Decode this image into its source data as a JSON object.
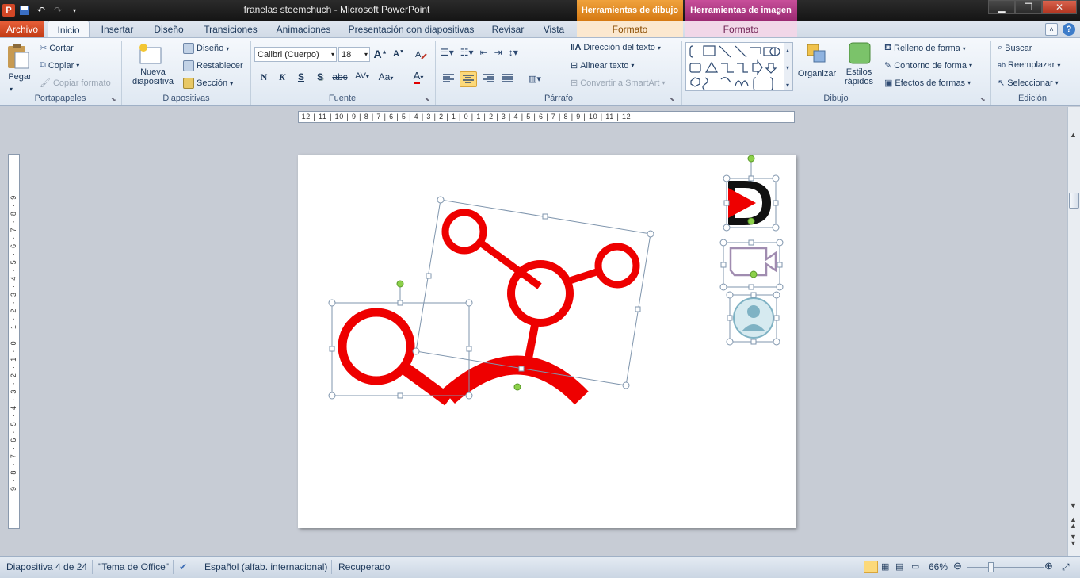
{
  "title_bar": {
    "document_title": "franelas steemchuch  -  Microsoft PowerPoint",
    "context_tabs": [
      "Herramientas de dibujo",
      "Herramientas de imagen"
    ],
    "app_icon": "P"
  },
  "tabs": {
    "file": "Archivo",
    "items": [
      "Inicio",
      "Insertar",
      "Diseño",
      "Transiciones",
      "Animaciones",
      "Presentación con diapositivas",
      "Revisar",
      "Vista"
    ],
    "context_sub": [
      "Formato",
      "Formato"
    ]
  },
  "ribbon": {
    "clipboard": {
      "paste": "Pegar",
      "cut": "Cortar",
      "copy": "Copiar",
      "format_painter": "Copiar formato",
      "label": "Portapapeles"
    },
    "slides": {
      "new_slide_1": "Nueva",
      "new_slide_2": "diapositiva",
      "layout": "Diseño",
      "reset": "Restablecer",
      "section": "Sección",
      "label": "Diapositivas"
    },
    "font": {
      "font_name": "Calibri (Cuerpo)",
      "font_size": "18",
      "bold": "N",
      "italic": "K",
      "underline": "S",
      "shadow": "S",
      "strike": "abc",
      "spacing": "AV",
      "case": "Aa",
      "color": "A",
      "grow": "A",
      "shrink": "A",
      "label": "Fuente"
    },
    "paragraph": {
      "text_direction": "Dirección del texto",
      "align_text": "Alinear texto",
      "smartart": "Convertir a SmartArt",
      "label": "Párrafo"
    },
    "drawing": {
      "arrange": "Organizar",
      "quick_styles_1": "Estilos",
      "quick_styles_2": "rápidos",
      "fill": "Relleno de forma",
      "outline": "Contorno de forma",
      "effects": "Efectos de formas",
      "label": "Dibujo"
    },
    "editing": {
      "find": "Buscar",
      "replace": "Reemplazar",
      "select": "Seleccionar",
      "label": "Edición"
    }
  },
  "ruler": {
    "horizontal": "·12·|·11·|·10·|·9·|·8·|·7·|·6·|·5·|·4·|·3·|·2·|·1·|·0·|·1·|·2·|·3·|·4·|·5·|·6·|·7·|·8·|·9·|·10·|·11·|·12·",
    "vertical": "9·8·7·6·5·4·3·2·1·0·1·2·3·4·5·6·7·8·9"
  },
  "status_bar": {
    "slide_info": "Diapositiva 4 de 24",
    "theme": "\"Tema de Office\"",
    "language": "Español (alfab. internacional)",
    "recovered": "Recuperado",
    "zoom": "66%"
  },
  "colors": {
    "accent_red": "#ee0000",
    "file_tab": "#d24726",
    "ctx_draw": "#e08a1e",
    "ctx_img": "#b03a84"
  }
}
